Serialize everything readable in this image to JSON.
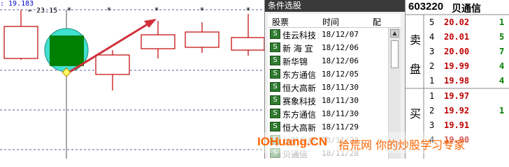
{
  "chart": {
    "price_top": ": 19.183",
    "price_mark": "← 23.15",
    "colors": {
      "candle": "#c00000",
      "circle": "#40e0d0",
      "box": "#008000",
      "arrow": "#d0303a",
      "grid": "#5060a0",
      "marker": "#ffff66"
    }
  },
  "picker": {
    "title": "条件选股",
    "headers": {
      "stock": "股票",
      "time": "时间",
      "config": "配"
    },
    "rows": [
      {
        "icon": "S",
        "name": "佳云科技",
        "date": "18/12/07"
      },
      {
        "icon": "S",
        "name": "新 海 宜",
        "date": "18/12/06"
      },
      {
        "icon": "S",
        "name": "新华锦",
        "date": "18/12/06"
      },
      {
        "icon": "S",
        "name": "东方通信",
        "date": "18/12/05"
      },
      {
        "icon": "S",
        "name": "恒大高新",
        "date": "18/11/30"
      },
      {
        "icon": "S",
        "name": "赛象科技",
        "date": "18/11/30"
      },
      {
        "icon": "S",
        "name": "东方通信",
        "date": "18/11/30"
      },
      {
        "icon": "S",
        "name": "恒大高新",
        "date": "18/11/29"
      },
      {
        "icon": "S",
        "name": "长航凤凰",
        "date": "18/11/28"
      },
      {
        "icon": "S",
        "name": "贝通信",
        "date": "18/11/28"
      }
    ]
  },
  "quote": {
    "code": "603220",
    "name": "贝通信",
    "sell_label_1": "卖",
    "sell_label_2": "盘",
    "buy_label": "买",
    "sell": [
      {
        "level": "5",
        "price": "20.02",
        "vol": "1"
      },
      {
        "level": "4",
        "price": "20.01",
        "vol": "5"
      },
      {
        "level": "3",
        "price": "20.00",
        "vol": "7"
      },
      {
        "level": "2",
        "price": "19.99",
        "vol": "4"
      },
      {
        "level": "1",
        "price": "19.98",
        "vol": "4"
      }
    ],
    "buy": [
      {
        "level": "1",
        "price": "19.97",
        "vol": ""
      },
      {
        "level": "2",
        "price": "19.92",
        "vol": "1"
      },
      {
        "level": "3",
        "price": "19.91",
        "vol": ""
      },
      {
        "level": "4",
        "price": "19.90",
        "vol": ""
      }
    ],
    "price_color": "#c00000"
  },
  "watermark": {
    "brand": "IOHuang.CN",
    "slogan": "拾荒网 你的炒股学习专家"
  }
}
